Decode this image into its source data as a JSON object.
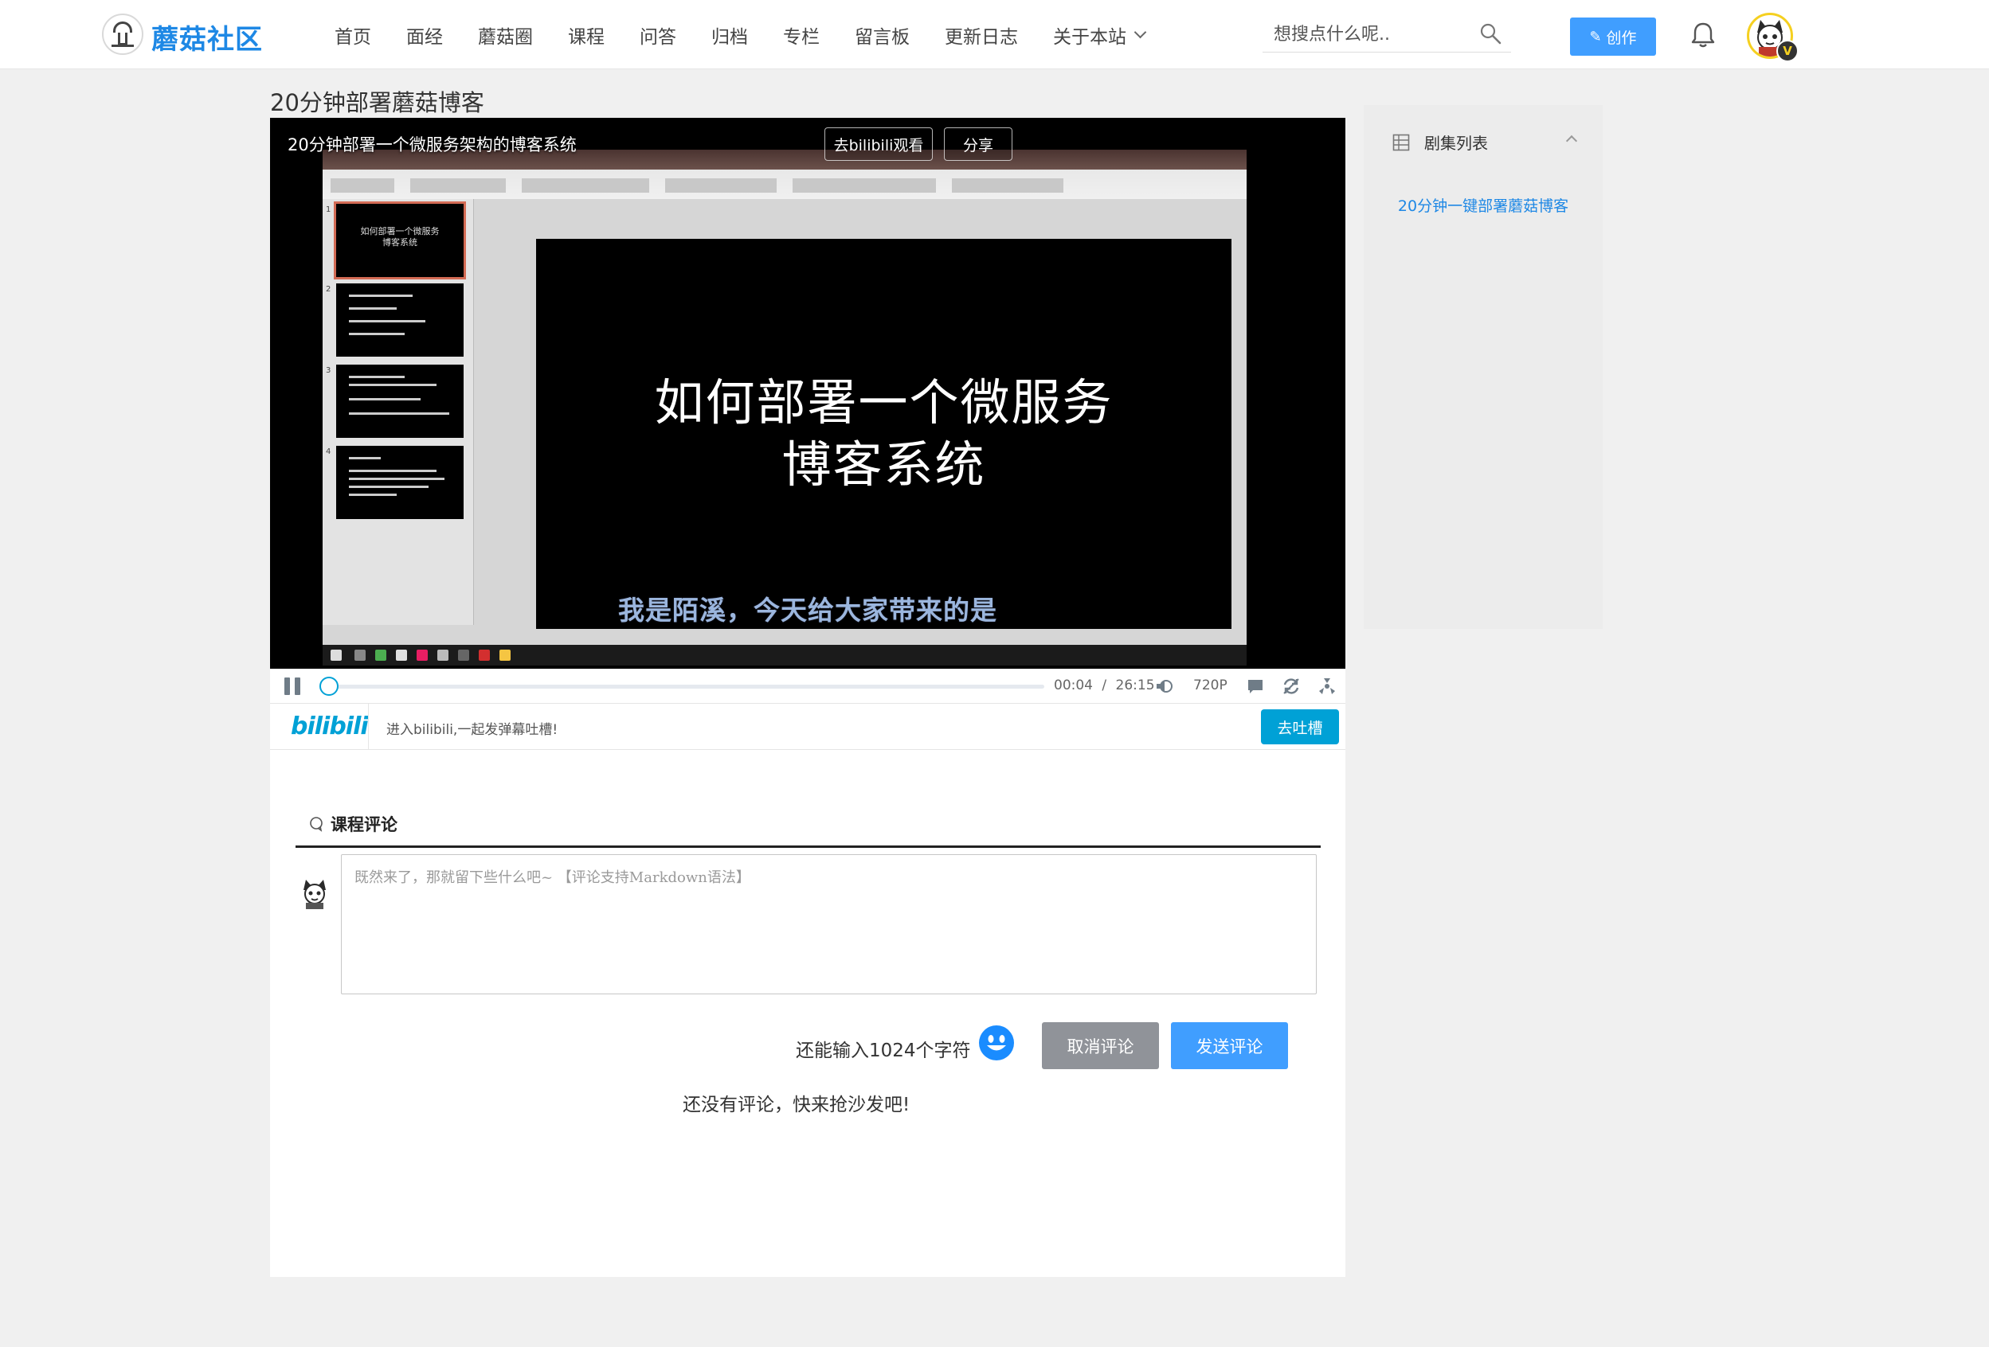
{
  "header": {
    "logo_text": "蘑菇社区",
    "nav": [
      "首页",
      "面经",
      "蘑菇圈",
      "课程",
      "问答",
      "归档",
      "专栏",
      "留言板",
      "更新日志",
      "关于本站"
    ],
    "search_placeholder": "想搜点什么呢..",
    "write_button": "创作",
    "vip_badge": "V"
  },
  "page_title": "20分钟部署蘑菇博客",
  "player": {
    "video_title": "20分钟部署一个微服务架构的博客系统",
    "open_bilibili": "去bilibili观看",
    "share": "分享",
    "video": {
      "slide_lines": [
        "如何部署一个微服务",
        "博客系统"
      ],
      "thumb_title": "如何部署一个微服务\n博客系统",
      "subtitle": "我是陌溪，今天给大家带来的是"
    },
    "current_time": "00:04",
    "time_separator": "/",
    "duration": "26:15",
    "progress": 0.0025,
    "quality": "720P",
    "bili_logo": "bilibili",
    "danmaku_prompt": "进入bilibili,一起发弹幕吐槽!",
    "danmaku_button": "去吐槽"
  },
  "comments": {
    "title": "课程评论",
    "placeholder": "既然来了，那就留下些什么吧~ 【评论支持Markdown语法】",
    "char_count": "还能输入1024个字符",
    "cancel": "取消评论",
    "submit": "发送评论",
    "empty": "还没有评论，快来抢沙发吧!"
  },
  "sidebar": {
    "title": "剧集列表",
    "episodes": [
      "20分钟一键部署蘑菇博客"
    ]
  },
  "colors": {
    "primary": "#409eff",
    "bilibili": "#00a1d6",
    "logo": "#1e88e5",
    "cancel": "#909399"
  }
}
